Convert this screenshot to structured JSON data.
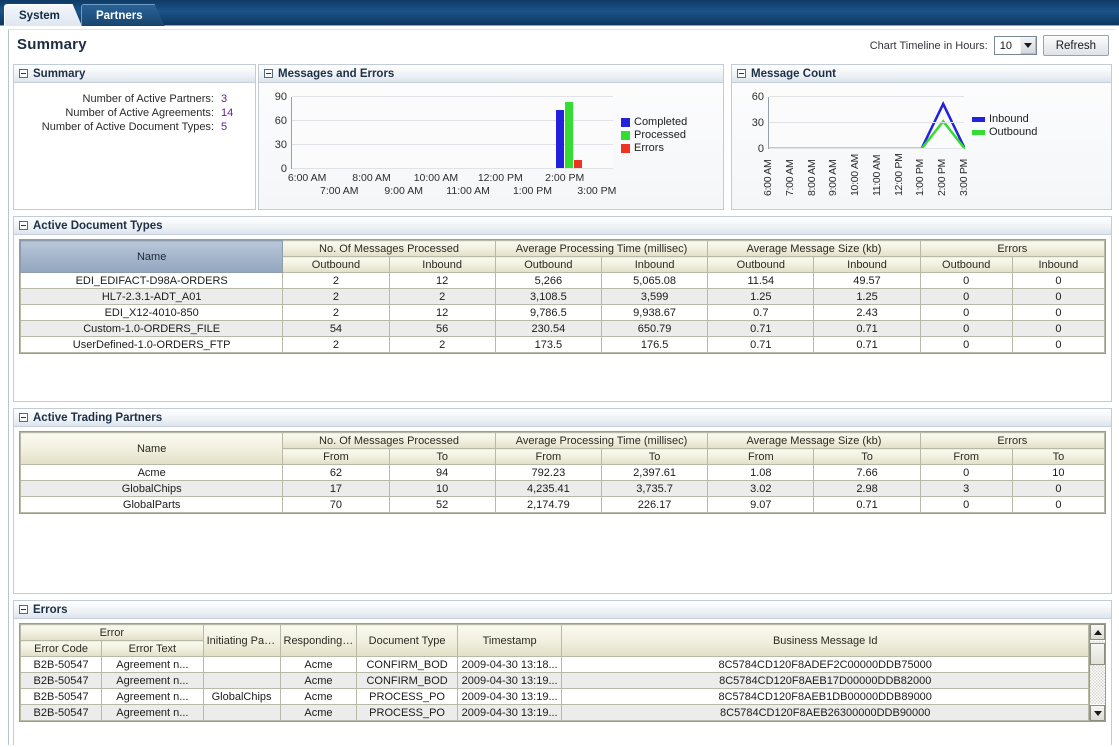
{
  "tabs": [
    {
      "label": "System",
      "active": true
    },
    {
      "label": "Partners",
      "active": false
    }
  ],
  "page": {
    "title": "Summary"
  },
  "toolbar": {
    "timeline_label": "Chart Timeline in Hours:",
    "timeline_value": "10",
    "refresh_label": "Refresh"
  },
  "summary_panel": {
    "title": "Summary",
    "stats": [
      {
        "label": "Number of Active Partners:",
        "value": "3"
      },
      {
        "label": "Number of Active Agreements:",
        "value": "14"
      },
      {
        "label": "Number of Active Document Types:",
        "value": "5"
      }
    ]
  },
  "messages_panel": {
    "title": "Messages and Errors"
  },
  "count_panel": {
    "title": "Message Count"
  },
  "chart_data": [
    {
      "type": "bar",
      "title": "Messages and Errors",
      "xlabel": "",
      "ylabel": "",
      "ylim": [
        0,
        90
      ],
      "yticks": [
        0,
        30,
        60,
        90
      ],
      "grid": true,
      "legend_position": "right",
      "categories": [
        "6:00 AM",
        "7:00 AM",
        "8:00 AM",
        "9:00 AM",
        "10:00 AM",
        "11:00 AM",
        "12:00 PM",
        "1:00 PM",
        "2:00 PM",
        "3:00 PM"
      ],
      "series": [
        {
          "name": "Completed",
          "color": "#2222dd",
          "values": [
            0,
            0,
            0,
            0,
            0,
            0,
            0,
            0,
            72,
            0
          ]
        },
        {
          "name": "Processed",
          "color": "#33dd33",
          "values": [
            0,
            0,
            0,
            0,
            0,
            0,
            0,
            0,
            82,
            0
          ]
        },
        {
          "name": "Errors",
          "color": "#ee3322",
          "values": [
            0,
            0,
            0,
            0,
            0,
            0,
            0,
            0,
            10,
            0
          ]
        }
      ]
    },
    {
      "type": "line",
      "title": "Message Count",
      "xlabel": "",
      "ylabel": "",
      "ylim": [
        0,
        60
      ],
      "yticks": [
        0,
        30,
        60
      ],
      "grid": true,
      "legend_position": "right",
      "categories": [
        "6:00 AM",
        "7:00 AM",
        "8:00 AM",
        "9:00 AM",
        "10:00 AM",
        "11:00 AM",
        "12:00 PM",
        "1:00 PM",
        "2:00 PM",
        "3:00 PM"
      ],
      "series": [
        {
          "name": "Inbound",
          "color": "#2222dd",
          "values": [
            0,
            0,
            0,
            0,
            0,
            0,
            0,
            0,
            52,
            0
          ]
        },
        {
          "name": "Outbound",
          "color": "#33dd33",
          "values": [
            0,
            0,
            0,
            0,
            0,
            0,
            0,
            0,
            32,
            0
          ]
        }
      ]
    }
  ],
  "doc_types": {
    "title": "Active Document Types",
    "group_headers": [
      {
        "label": "Name",
        "span": 1,
        "rowspan": 2,
        "sorted": true
      },
      {
        "label": "No. Of Messages Processed",
        "span": 2
      },
      {
        "label": "Average Processing Time (millisec)",
        "span": 2
      },
      {
        "label": "Average Message Size (kb)",
        "span": 2
      },
      {
        "label": "Errors",
        "span": 2
      }
    ],
    "sub_headers": [
      "Outbound",
      "Inbound",
      "Outbound",
      "Inbound",
      "Outbound",
      "Inbound",
      "Outbound",
      "Inbound"
    ],
    "rows": [
      {
        "name": "EDI_EDIFACT-D98A-ORDERS",
        "cells": [
          "2",
          "12",
          "5,266",
          "5,065.08",
          "11.54",
          "49.57",
          "0",
          "0"
        ]
      },
      {
        "name": "HL7-2.3.1-ADT_A01",
        "cells": [
          "2",
          "2",
          "3,108.5",
          "3,599",
          "1.25",
          "1.25",
          "0",
          "0"
        ]
      },
      {
        "name": "EDI_X12-4010-850",
        "cells": [
          "2",
          "12",
          "9,786.5",
          "9,938.67",
          "0.7",
          "2.43",
          "0",
          "0"
        ]
      },
      {
        "name": "Custom-1.0-ORDERS_FILE",
        "cells": [
          "54",
          "56",
          "230.54",
          "650.79",
          "0.71",
          "0.71",
          "0",
          "0"
        ]
      },
      {
        "name": "UserDefined-1.0-ORDERS_FTP",
        "cells": [
          "2",
          "2",
          "173.5",
          "176.5",
          "0.71",
          "0.71",
          "0",
          "0"
        ]
      }
    ]
  },
  "partners": {
    "title": "Active Trading Partners",
    "group_headers": [
      {
        "label": "Name",
        "span": 1,
        "rowspan": 2,
        "sorted": false
      },
      {
        "label": "No. Of Messages Processed",
        "span": 2
      },
      {
        "label": "Average Processing Time (millisec)",
        "span": 2
      },
      {
        "label": "Average Message Size (kb)",
        "span": 2
      },
      {
        "label": "Errors",
        "span": 2
      }
    ],
    "sub_headers": [
      "From",
      "To",
      "From",
      "To",
      "From",
      "To",
      "From",
      "To"
    ],
    "rows": [
      {
        "name": "Acme",
        "cells": [
          "62",
          "94",
          "792.23",
          "2,397.61",
          "1.08",
          "7.66",
          "0",
          "10"
        ]
      },
      {
        "name": "GlobalChips",
        "cells": [
          "17",
          "10",
          "4,235.41",
          "3,735.7",
          "3.02",
          "2.98",
          "3",
          "0"
        ]
      },
      {
        "name": "GlobalParts",
        "cells": [
          "70",
          "52",
          "2,174.79",
          "226.17",
          "9.07",
          "0.71",
          "0",
          "0"
        ]
      }
    ]
  },
  "errors": {
    "title": "Errors",
    "group_headers": [
      {
        "label": "Error",
        "span": 2
      },
      {
        "label": "Initiating Partner",
        "span": 1,
        "rowspan": 2
      },
      {
        "label": "Responding Partner",
        "span": 1,
        "rowspan": 2
      },
      {
        "label": "Document Type",
        "span": 1,
        "rowspan": 2
      },
      {
        "label": "Timestamp",
        "span": 1,
        "rowspan": 2
      },
      {
        "label": "Business Message Id",
        "span": 1,
        "rowspan": 2
      }
    ],
    "sub_headers": [
      "Error Code",
      "Error Text"
    ],
    "rows": [
      {
        "code": "B2B-50547",
        "text": "Agreement n...",
        "initiating": "",
        "responding": "Acme",
        "doctype": "CONFIRM_BOD",
        "timestamp": "2009-04-30 13:18...",
        "msgid": "8C5784CD120F8ADEF2C00000DDB75000"
      },
      {
        "code": "B2B-50547",
        "text": "Agreement n...",
        "initiating": "",
        "responding": "Acme",
        "doctype": "CONFIRM_BOD",
        "timestamp": "2009-04-30 13:19...",
        "msgid": "8C5784CD120F8AEB17D00000DDB82000"
      },
      {
        "code": "B2B-50547",
        "text": "Agreement n...",
        "initiating": "GlobalChips",
        "responding": "Acme",
        "doctype": "PROCESS_PO",
        "timestamp": "2009-04-30 13:19...",
        "msgid": "8C5784CD120F8AEB1DB00000DDB89000"
      },
      {
        "code": "B2B-50547",
        "text": "Agreement n...",
        "initiating": "",
        "responding": "Acme",
        "doctype": "PROCESS_PO",
        "timestamp": "2009-04-30 13:19...",
        "msgid": "8C5784CD120F8AEB26300000DDB90000"
      }
    ]
  }
}
